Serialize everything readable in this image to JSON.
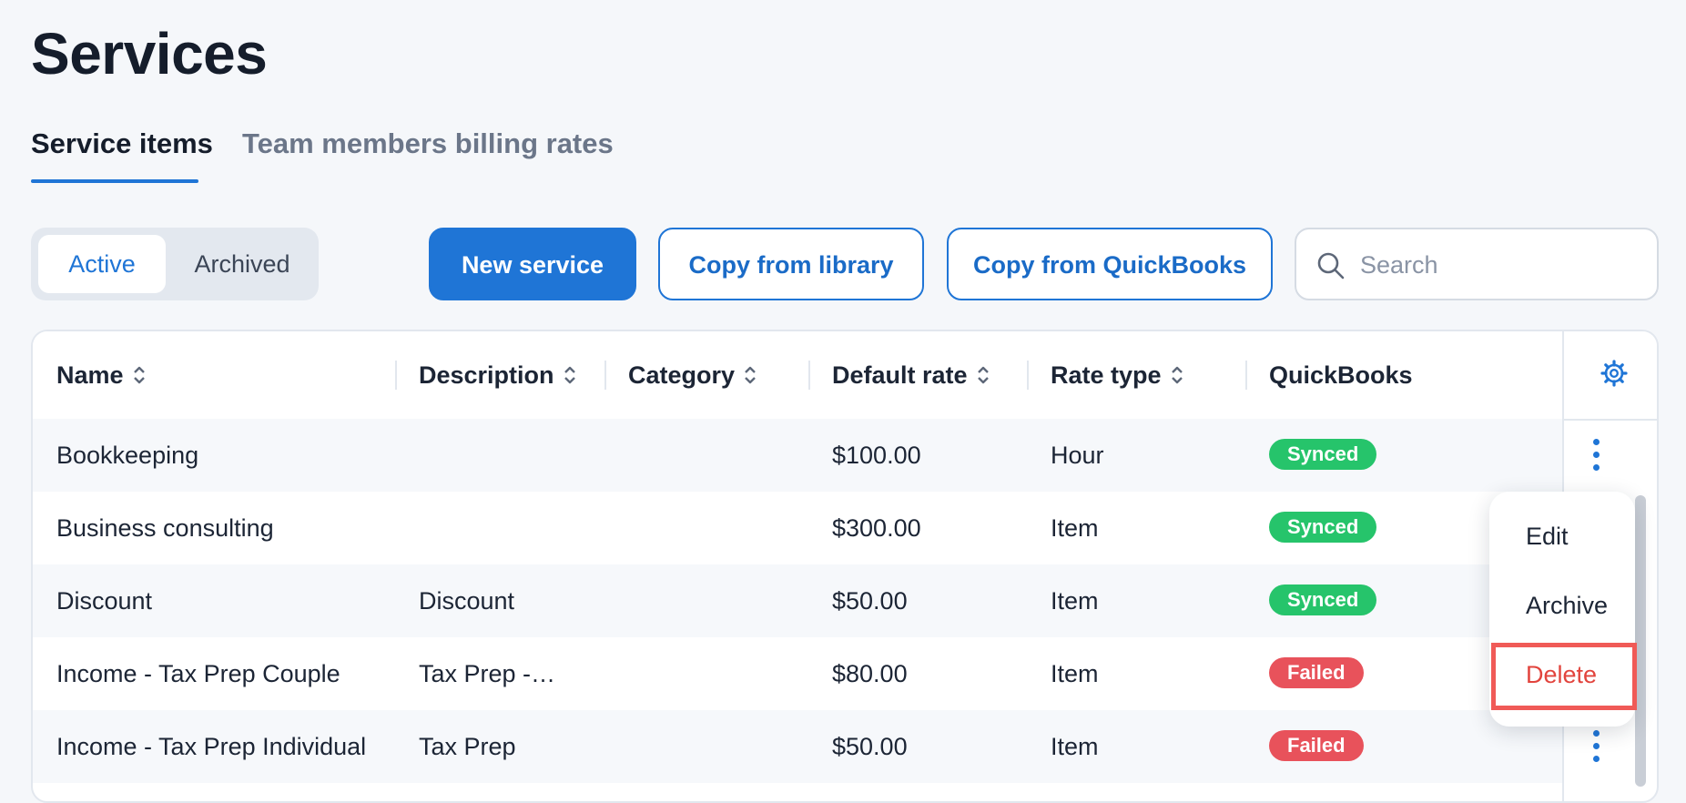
{
  "page": {
    "title": "Services"
  },
  "tabs": [
    {
      "label": "Service items",
      "active": true
    },
    {
      "label": "Team members billing rates",
      "active": false
    }
  ],
  "filter": {
    "options": [
      "Active",
      "Archived"
    ],
    "selected": "Active"
  },
  "buttons": {
    "new_service": "New service",
    "copy_library": "Copy from library",
    "copy_quickbooks": "Copy from QuickBooks"
  },
  "search": {
    "placeholder": "Search",
    "value": ""
  },
  "table": {
    "columns": [
      "Name",
      "Description",
      "Category",
      "Default rate",
      "Rate type",
      "QuickBooks"
    ],
    "rows": [
      {
        "name": "Bookkeeping",
        "description": "",
        "category": "",
        "default_rate": "$100.00",
        "rate_type": "Hour",
        "quickbooks": "Synced"
      },
      {
        "name": "Business consulting",
        "description": "",
        "category": "",
        "default_rate": "$300.00",
        "rate_type": "Item",
        "quickbooks": "Synced"
      },
      {
        "name": "Discount",
        "description": "Discount",
        "category": "",
        "default_rate": "$50.00",
        "rate_type": "Item",
        "quickbooks": "Synced"
      },
      {
        "name": "Income - Tax Prep Couple",
        "description": "Tax Prep -…",
        "category": "",
        "default_rate": "$80.00",
        "rate_type": "Item",
        "quickbooks": "Failed"
      },
      {
        "name": "Income - Tax Prep Individual",
        "description": "Tax Prep",
        "category": "",
        "default_rate": "$50.00",
        "rate_type": "Item",
        "quickbooks": "Failed"
      }
    ]
  },
  "context_menu": {
    "items": [
      "Edit",
      "Archive",
      "Delete"
    ]
  },
  "colors": {
    "accent": "#1f75d6",
    "synced": "#26c46b",
    "failed": "#e8525b",
    "danger": "#e2443d",
    "highlight": "#f05a57"
  },
  "icons": [
    "search-icon",
    "gear-icon",
    "sort-icon",
    "kebab-icon"
  ]
}
